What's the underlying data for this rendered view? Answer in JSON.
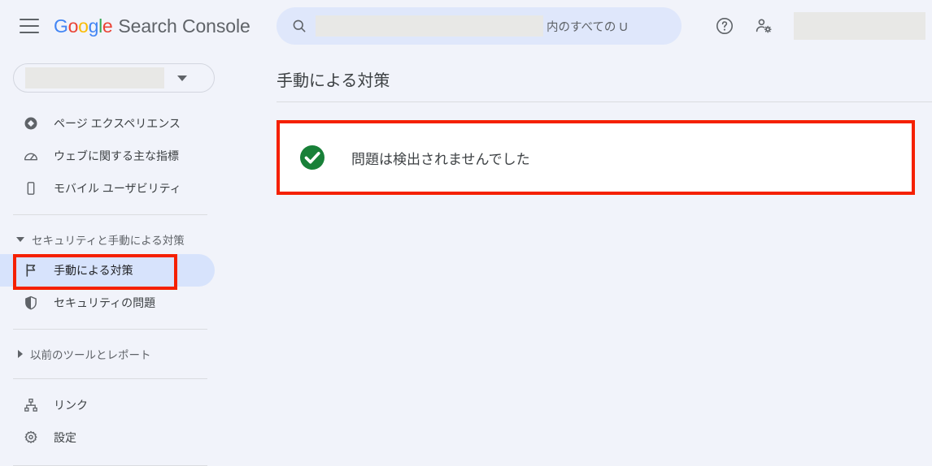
{
  "header": {
    "menu_icon": "hamburger-menu-icon",
    "logo_letters": [
      "G",
      "o",
      "o",
      "g",
      "l",
      "e"
    ],
    "product_name": "Search Console",
    "search": {
      "icon": "search-icon",
      "redacted_value": "",
      "placeholder_suffix": "内のすべての U"
    },
    "help_icon": "help-circle-icon",
    "account_settings_icon": "account-settings-icon",
    "avatar_redacted": ""
  },
  "sidebar": {
    "property_selector": {
      "name": "property-selector",
      "redacted_value": "",
      "caret_icon": "chevron-down-icon"
    },
    "items": [
      {
        "label": "ページ エクスペリエンス",
        "icon": "page-experience-icon",
        "selected": false
      },
      {
        "label": "ウェブに関する主な指標",
        "icon": "core-web-vitals-gauge-icon",
        "selected": false
      },
      {
        "label": "モバイル ユーザビリティ",
        "icon": "mobile-phone-icon",
        "selected": false
      }
    ],
    "security_group": {
      "label": "セキュリティと手動による対策",
      "expanded": true,
      "caret_icon": "caret-down-icon",
      "items": [
        {
          "label": "手動による対策",
          "icon": "flag-icon",
          "selected": true
        },
        {
          "label": "セキュリティの問題",
          "icon": "shield-icon",
          "selected": false
        }
      ]
    },
    "legacy_group": {
      "label": "以前のツールとレポート",
      "expanded": false,
      "caret_icon": "caret-right-icon"
    },
    "footer_items": [
      {
        "label": "リンク",
        "icon": "links-hierarchy-icon"
      },
      {
        "label": "設定",
        "icon": "gear-icon"
      }
    ]
  },
  "main": {
    "page_title": "手動による対策",
    "status_card": {
      "icon": "green-check-circle-icon",
      "message": "問題は検出されませんでした"
    }
  },
  "colors": {
    "background": "#f1f3fa",
    "card_background": "#ffffff",
    "annotation_red": "#f52000",
    "success_green": "#188038",
    "selected_pill": "#d7e3fc",
    "search_background": "#dfe7fb",
    "redaction_gray": "#e8e8e6",
    "text_primary": "#3c4043",
    "text_secondary": "#5f6368"
  }
}
